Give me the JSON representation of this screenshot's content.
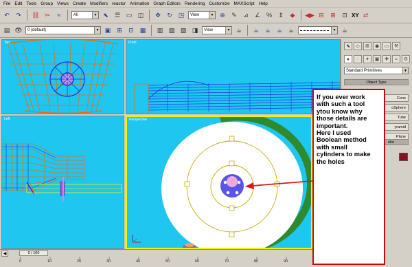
{
  "menu": [
    "File",
    "Edit",
    "Tools",
    "Group",
    "Views",
    "Create",
    "Modifiers",
    "reactor",
    "Animation",
    "Graph Editors",
    "Rendering",
    "Customize",
    "MAXScript",
    "Help"
  ],
  "toolbar1": {
    "selection_filter": "All",
    "ref_coord": "View",
    "axis_label": "XY"
  },
  "toolbar2": {
    "layer": "0 (default)",
    "ref_coord": "View"
  },
  "viewports": {
    "top": "Top",
    "front": "Front",
    "left": "Left",
    "perspective": "Perspective"
  },
  "command_panel": {
    "category": "Standard Primitives",
    "object_type_header": "Object Type",
    "buttons": [
      "Cone",
      "oSphere",
      "Tube",
      "yramid",
      "Plane"
    ],
    "name_color_header": "olor"
  },
  "callout": {
    "text": "If you ever work\nwith such a tool\nytou know why\nthose details are\nimportant.\nHere I used\nBoolean method\nwith small\ncylinders to make\nthe holes"
  },
  "timeline": {
    "position": "0 / 100",
    "ticks": [
      "0",
      "10",
      "20",
      "30",
      "40",
      "50",
      "60",
      "70",
      "80",
      "90"
    ]
  },
  "colors": {
    "viewport_bg": "#1fc6f0",
    "callout_border": "#c20b0b",
    "arrow": "#d61a1a",
    "active_viewport": "#f4f400",
    "wire_orange": "#e0701a",
    "wire_blue": "#1d2ee6",
    "ring_green": "#2f8a2f"
  }
}
